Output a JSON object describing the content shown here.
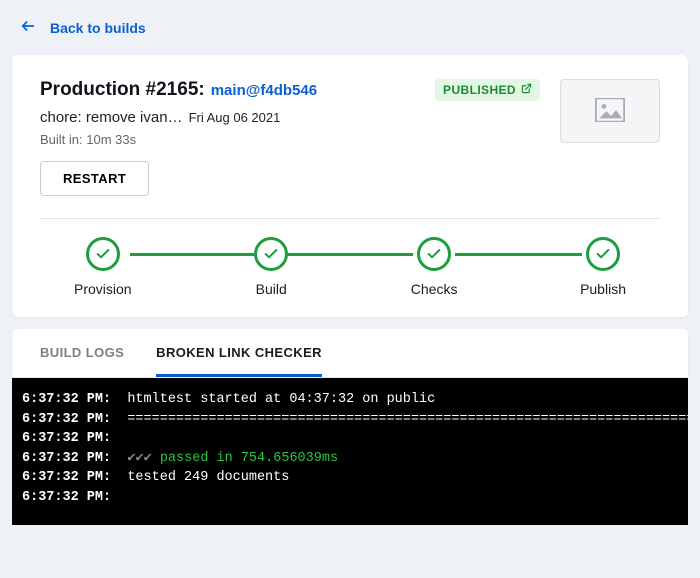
{
  "nav": {
    "back_label": "Back to builds"
  },
  "build": {
    "title": "Production #2165:",
    "branch_link": "main@f4db546",
    "commit_message": "chore: remove ivan…",
    "date": "Fri Aug 06 2021",
    "built_in_prefix": "Built in:",
    "built_in_value": "10m 33s",
    "status_label": "PUBLISHED",
    "restart_label": "RESTART"
  },
  "stages": [
    {
      "label": "Provision"
    },
    {
      "label": "Build"
    },
    {
      "label": "Checks"
    },
    {
      "label": "Publish"
    }
  ],
  "tabs": [
    {
      "label": "BUILD LOGS",
      "active": false
    },
    {
      "label": "BROKEN LINK CHECKER",
      "active": true
    }
  ],
  "log": {
    "lines": [
      {
        "ts": "6:37:32 PM:",
        "text": "htmltest started at 04:37:32 on public"
      },
      {
        "ts": "6:37:32 PM:",
        "text": "========================================================================"
      },
      {
        "ts": "6:37:32 PM:",
        "text": ""
      },
      {
        "ts": "6:37:32 PM:",
        "checks": "✔✔✔",
        "pass": " passed in 754.656039ms"
      },
      {
        "ts": "6:37:32 PM:",
        "text": "tested 249 documents"
      },
      {
        "ts": "6:37:32 PM:",
        "text": ""
      }
    ]
  }
}
